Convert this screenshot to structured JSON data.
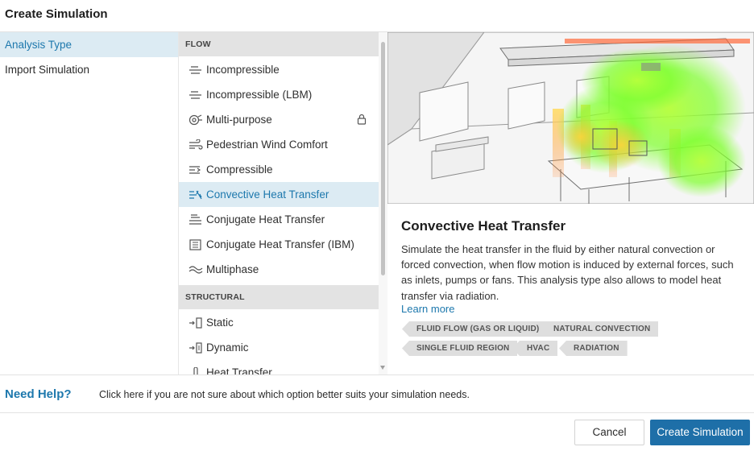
{
  "dialog": {
    "title": "Create Simulation"
  },
  "left_nav": {
    "items": [
      {
        "label": "Analysis Type",
        "active": true
      },
      {
        "label": "Import Simulation",
        "active": false
      }
    ]
  },
  "analysis_list": {
    "sections": [
      {
        "header": "FLOW"
      },
      {
        "header": "STRUCTURAL"
      }
    ],
    "flow_options": [
      {
        "label": "Incompressible",
        "icon": "incompressible-icon"
      },
      {
        "label": "Incompressible (LBM)",
        "icon": "incompressible-lbm-icon"
      },
      {
        "label": "Multi-purpose",
        "icon": "multi-purpose-icon",
        "locked": true
      },
      {
        "label": "Pedestrian Wind Comfort",
        "icon": "wind-comfort-icon"
      },
      {
        "label": "Compressible",
        "icon": "compressible-icon"
      },
      {
        "label": "Convective Heat Transfer",
        "icon": "convective-heat-icon",
        "selected": true
      },
      {
        "label": "Conjugate Heat Transfer",
        "icon": "conjugate-heat-icon"
      },
      {
        "label": "Conjugate Heat Transfer (IBM)",
        "icon": "conjugate-ibm-icon"
      },
      {
        "label": "Multiphase",
        "icon": "multiphase-icon"
      }
    ],
    "structural_options": [
      {
        "label": "Static",
        "icon": "static-icon"
      },
      {
        "label": "Dynamic",
        "icon": "dynamic-icon"
      },
      {
        "label": "Heat Transfer",
        "icon": "heat-transfer-icon"
      }
    ]
  },
  "description": {
    "title": "Convective Heat Transfer",
    "text": "Simulate the heat transfer in the fluid by either natural convection or forced convection, when flow motion is induced by external forces, such as inlets, pumps or fans. This analysis type also allows to model heat transfer via radiation.",
    "learn_more": "Learn more",
    "tags": [
      "FLUID FLOW (GAS OR LIQUID)",
      "NATURAL CONVECTION",
      "SINGLE FLUID REGION",
      "HVAC",
      "RADIATION"
    ]
  },
  "help": {
    "title": "Need Help?",
    "text": "Click here if you are not sure about which option better suits your simulation needs."
  },
  "footer": {
    "cancel_label": "Cancel",
    "create_label": "Create Simulation"
  },
  "colors": {
    "accent": "#1d78ad",
    "selected_bg": "#dcebf3",
    "primary_button": "#1e6fa8",
    "section_header_bg": "#e3e3e3",
    "tag_bg": "#dedede"
  }
}
